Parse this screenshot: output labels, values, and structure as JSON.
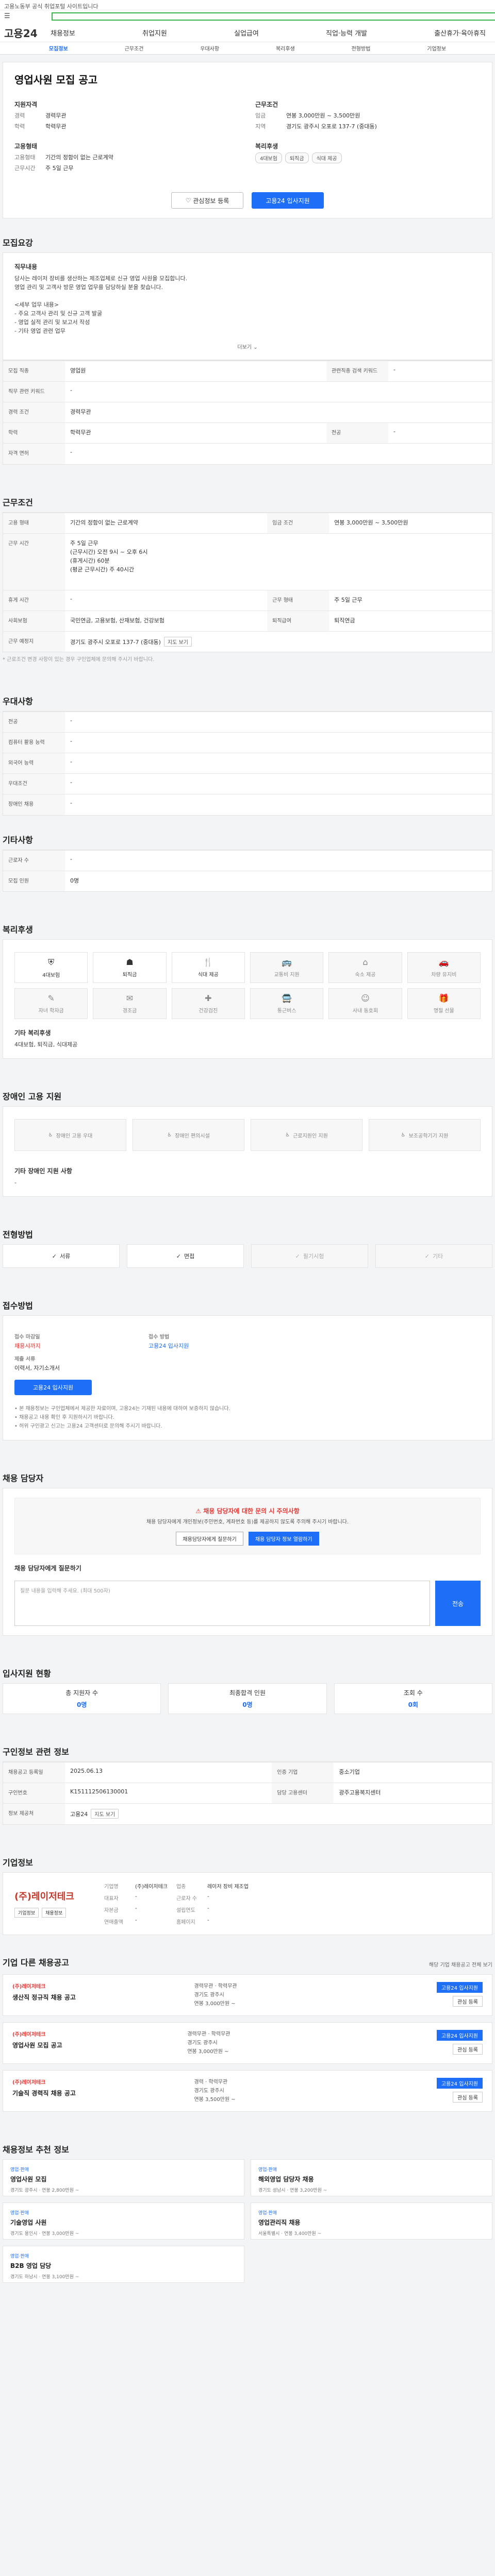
{
  "topbar": {
    "text": "고용노동부 공식 취업포털 사이트입니다"
  },
  "header": {
    "logo": "고용24",
    "nav": [
      "채용정보",
      "취업지원",
      "실업급여",
      "직업·능력 개발",
      "출산휴가·육아휴직"
    ]
  },
  "tabs": [
    "모집정보",
    "근무조건",
    "우대사항",
    "복리후생",
    "전형방법",
    "기업정보"
  ],
  "job": {
    "title": "영업사원 모집 공고",
    "labels": {
      "qualification": "지원자격",
      "conditions": "근무조건",
      "career": "경력",
      "education": "학력",
      "employ_type": "고용형태",
      "wage": "임금",
      "location": "지역",
      "hours": "근무시간",
      "welfare": "복리후생"
    },
    "career": "경력무관",
    "education": "학력무관",
    "employ_type": "기간의 정함이 없는 근로계약",
    "wage": "연봉 3,000만원 ~ 3,500만원",
    "location": "경기도 광주시 오포로 137-7 (중대동)",
    "hours": "주 5일 근무",
    "welfare_chips": [
      "4대보험",
      "퇴직금",
      "식대 제공"
    ],
    "btn_scrap": "관심정보 등록",
    "btn_apply": "고용24 입사지원"
  },
  "recruit": {
    "title": "모집요강",
    "sub": "직무내용",
    "content": "당사는 레이저 장비를 생산하는 제조업체로 신규 영업 사원을 모집합니다.\n영업 관리 및 고객사 방문 영업 업무를 담당하실 분을 찾습니다.\n\n<세부 업무 내용>\n - 주요 고객사 관리 및 신규 고객 발굴\n - 영업 실적 관리 및 보고서 작성\n - 기타 영업 관련 업무",
    "toggle": "더보기",
    "rows": [
      [
        "모집 직종",
        "영업원",
        "관련직종 검색 키워드",
        "-"
      ],
      [
        "직무 관련 키워드",
        "-",
        "",
        ""
      ],
      [
        "경력 조건",
        "경력무관",
        "",
        ""
      ],
      [
        "학력",
        "학력무관",
        "전공",
        "-"
      ],
      [
        "자격 면허",
        "-",
        "",
        ""
      ]
    ]
  },
  "work": {
    "title": "근무조건",
    "rows": [
      [
        "고용 형태",
        "기간의 정함이 없는 근로계약",
        "임금 조건",
        "연봉 3,000만원 ~ 3,500만원"
      ],
      [
        "근무 시간",
        "주 5일 근무\n(근무시간) 오전 9시 ~ 오후 6시\n(휴게시간) 60분\n(평균 근무시간) 주 40시간",
        "",
        ""
      ],
      [
        "휴게 시간",
        "-",
        "근무 형태",
        "주 5일 근무"
      ],
      [
        "사회보험",
        "국민연금, 고용보험, 산재보험, 건강보험",
        "퇴직급여",
        "퇴직연금"
      ],
      [
        "근무 예정지",
        "경기도 광주시 오포로 137-7 (중대동)",
        "",
        ""
      ]
    ],
    "map_btn": "지도 보기",
    "note": "* 근로조건 변경 사항이 있는 경우 구인업체에 문의해 주시기 바랍니다."
  },
  "prefer": {
    "title": "우대사항",
    "rows": [
      [
        "전공",
        "-"
      ],
      [
        "컴퓨터 활용 능력",
        "-"
      ],
      [
        "외국어 능력",
        "-"
      ],
      [
        "우대조건",
        "-"
      ],
      [
        "장애인 채용",
        "-"
      ]
    ]
  },
  "etc": {
    "title": "기타사항",
    "rows": [
      [
        "근로자 수",
        "-"
      ],
      [
        "모집 인원",
        "0명"
      ]
    ]
  },
  "welfare": {
    "title": "복리후생",
    "items": [
      "4대보험",
      "퇴직금",
      "식대 제공",
      "교통비 지원",
      "숙소 제공",
      "차량 유지비",
      "자녀 학자금",
      "경조금",
      "건강검진",
      "통근버스",
      "사내 동호회",
      "명절 선물"
    ],
    "on": [
      0,
      1,
      2
    ],
    "extra_label": "기타 복리후생",
    "extra_value": "4대보험, 퇴직금, 식대제공"
  },
  "disability": {
    "title": "장애인 고용 지원",
    "items": [
      "장애인 고용 우대",
      "장애인 편의시설",
      "근로지원인 지원",
      "보조공학기기 지원"
    ],
    "extra_label": "기타 장애인 지원 사항",
    "extra_value": "-"
  },
  "process": {
    "title": "전형방법",
    "items": [
      "서류",
      "면접",
      "필기시험",
      "기타"
    ],
    "on": [
      0,
      1
    ]
  },
  "apply": {
    "title": "접수방법",
    "deadline_label": "접수 마감일",
    "deadline": "채용시까지",
    "method_label": "접수 방법",
    "method": "고용24 입사지원",
    "docs_label": "제출 서류",
    "docs": "이력서, 자기소개서",
    "btn": "고용24 입사지원",
    "notices": [
      "• 본 채용정보는 구인업체에서 제공한 자료이며, 고용24는 기재된 내용에 대하여 보증하지 않습니다.",
      "• 채용공고 내용 확인 후 지원하시기 바랍니다.",
      "• 허위 구인광고 신고는 고용24 고객센터로 문의해 주시기 바랍니다."
    ]
  },
  "qa": {
    "title": "채용 담당자",
    "warn": "채용 담당자에 대한 문의 시 주의사항",
    "text": "채용 담당자에게 개인정보(주민번호, 계좌번호 등)를 제공하지 않도록 주의해 주시기 바랍니다.",
    "btn1": "채용담당자에게 질문하기",
    "btn2": "채용 담당자 정보 열람하기",
    "form_label": "채용 담당자에게 질문하기",
    "placeholder": "질문 내용을 입력해 주세요. (최대 500자)",
    "send": "전송"
  },
  "stats": {
    "title": "입사지원 현황",
    "items": [
      [
        "총 지원자 수",
        "0명"
      ],
      [
        "최종합격 인원",
        "0명"
      ],
      [
        "조회 수",
        "0회"
      ]
    ]
  },
  "info2": {
    "title": "구인정보 관련 정보",
    "rows": [
      [
        "채용공고 등록일",
        "2025.06.13",
        "인증 기업",
        "중소기업",
        "구인번호",
        "K151112506130001"
      ],
      [
        "담당 고용센터",
        "광주고용복지센터",
        "정보 제공처",
        "고용24"
      ]
    ],
    "btn": "지도 보기"
  },
  "company": {
    "title": "기업정보",
    "name": "(주)레이저테크",
    "btn1": "기업정보",
    "btn2": "채용정보",
    "info": [
      [
        "기업명",
        "(주)레이저테크"
      ],
      [
        "업종",
        "레이저 장비 제조업"
      ],
      [
        "대표자",
        "-"
      ],
      [
        "근로자 수",
        "-"
      ],
      [
        "자본금",
        "-"
      ],
      [
        "설립연도",
        "-"
      ],
      [
        "연매출액",
        "-"
      ],
      [
        "홈페이지",
        "-"
      ]
    ]
  },
  "related": {
    "title": "기업 다른 채용공고",
    "link": "해당 기업 채용공고 전체 보기",
    "items": [
      {
        "corp": "(주)레이저테크",
        "title": "생산직 정규직 채용 공고",
        "meta": [
          "경력무관 · 학력무관",
          "경기도 광주시",
          "연봉 3,000만원 ~"
        ]
      },
      {
        "corp": "(주)레이저테크",
        "title": "영업사원 모집 공고",
        "meta": [
          "경력무관 · 학력무관",
          "경기도 광주시",
          "연봉 3,000만원 ~"
        ]
      },
      {
        "corp": "(주)레이저테크",
        "title": "기술직 경력직 채용 공고",
        "meta": [
          "경력 · 학력무관",
          "경기도 광주시",
          "연봉 3,500만원 ~"
        ]
      }
    ],
    "btn_apply": "고용24 입사지원",
    "btn_scrap": "관심 등록"
  },
  "similar": {
    "title": "채용정보 추천 정보",
    "items": [
      {
        "tag": "영업·판매",
        "title": "영업사원 모집",
        "meta": "경기도 광주시 · 연봉 2,800만원 ~"
      },
      {
        "tag": "영업·판매",
        "title": "해외영업 담당자 채용",
        "meta": "경기도 성남시 · 연봉 3,200만원 ~"
      },
      {
        "tag": "영업·판매",
        "title": "기술영업 사원",
        "meta": "경기도 용인시 · 연봉 3,000만원 ~"
      },
      {
        "tag": "영업·판매",
        "title": "영업관리직 채용",
        "meta": "서울특별시 · 연봉 3,400만원 ~"
      },
      {
        "tag": "영업·판매",
        "title": "B2B 영업 담당",
        "meta": "경기도 하남시 · 연봉 3,100만원 ~"
      }
    ]
  }
}
